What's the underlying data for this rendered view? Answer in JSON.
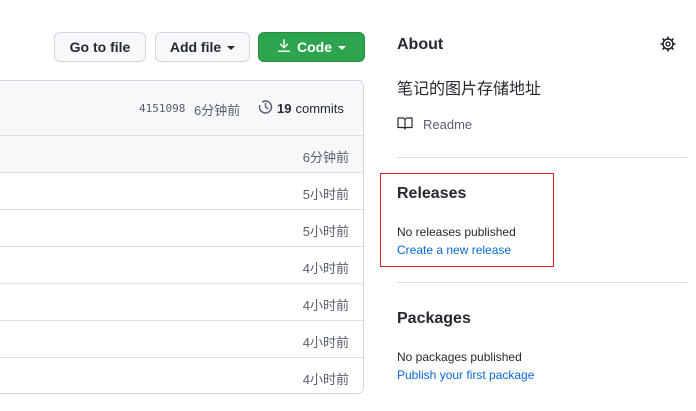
{
  "toolbar": {
    "goto_label": "Go to file",
    "add_label": "Add file",
    "code_label": "Code"
  },
  "panel": {
    "sha": "4151098",
    "sha_time": "6分钟前",
    "commits_count": "19",
    "commits_label": "commits",
    "rows": [
      "6分钟前",
      "5小时前",
      "5小时前",
      "4小时前",
      "4小时前",
      "4小时前",
      "4小时前"
    ]
  },
  "about": {
    "title": "About",
    "description": "笔记的图片存储地址",
    "readme_label": "Readme"
  },
  "releases": {
    "title": "Releases",
    "empty_text": "No releases published",
    "create_link": "Create a new release"
  },
  "packages": {
    "title": "Packages",
    "empty_text": "No packages published",
    "publish_link": "Publish your first package"
  },
  "colors": {
    "primary_button": "#2da44e",
    "link": "#0969da",
    "highlight_box": "#e0221e"
  },
  "icons": [
    "download-icon",
    "history-icon",
    "gear-icon",
    "book-icon"
  ]
}
